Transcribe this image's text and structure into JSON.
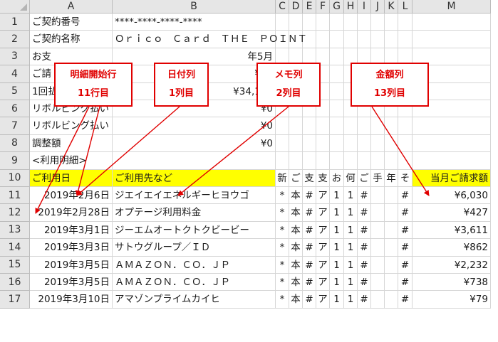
{
  "columns": [
    "A",
    "B",
    "C",
    "D",
    "E",
    "F",
    "G",
    "H",
    "I",
    "J",
    "K",
    "L",
    "M"
  ],
  "rows": [
    {
      "num": "1",
      "A": "ご契約番号",
      "B": "****-****-****-****"
    },
    {
      "num": "2",
      "A": "ご契約名称",
      "B": "Ｏｒｉｃｏ　Ｃａｒｄ　ＴＨＥ　ＰＯＩＮＴ"
    },
    {
      "num": "3",
      "A": "お支",
      "B": "年5月"
    },
    {
      "num": "4",
      "A": "ご請",
      "B": "¥34"
    },
    {
      "num": "5",
      "A": "1回払い分割払い",
      "B": "¥34,153"
    },
    {
      "num": "6",
      "A": "リボルビング払い",
      "B": "¥0"
    },
    {
      "num": "7",
      "A": "リボルビング払い",
      "B": "¥0"
    },
    {
      "num": "8",
      "A": "調整額",
      "B": "¥0"
    },
    {
      "num": "9",
      "A": "<利用明細>",
      "B": ""
    },
    {
      "num": "10",
      "A": "ご利用日",
      "B": "ご利用先など",
      "C": "新",
      "D": "ご",
      "E": "支",
      "F": "支",
      "G": "お",
      "H": "何",
      "I": "ご",
      "J": "手",
      "K": "年",
      "L": "そ",
      "M": "当月ご請求額"
    },
    {
      "num": "11",
      "A": "2019年2月6日",
      "B": "ジエイエイエネルギーヒヨウゴ",
      "C": "*",
      "D": "本",
      "E": "#",
      "F": "ア",
      "G": "1",
      "H": "1",
      "I": "#",
      "L": "#",
      "M": "¥6,030"
    },
    {
      "num": "12",
      "A": "2019年2月28日",
      "B": "オプテージ利用料金",
      "C": "*",
      "D": "本",
      "E": "#",
      "F": "ア",
      "G": "1",
      "H": "1",
      "I": "#",
      "L": "#",
      "M": "¥427"
    },
    {
      "num": "13",
      "A": "2019年3月1日",
      "B": "ジーエムオートクトクビービー",
      "C": "*",
      "D": "本",
      "E": "#",
      "F": "ア",
      "G": "1",
      "H": "1",
      "I": "#",
      "L": "#",
      "M": "¥3,611"
    },
    {
      "num": "14",
      "A": "2019年3月3日",
      "B": "サトウグループ／ＩＤ",
      "C": "*",
      "D": "本",
      "E": "#",
      "F": "ア",
      "G": "1",
      "H": "1",
      "I": "#",
      "L": "#",
      "M": "¥862"
    },
    {
      "num": "15",
      "A": "2019年3月5日",
      "B": "ＡＭＡＺＯＮ．ＣＯ．ＪＰ",
      "C": "*",
      "D": "本",
      "E": "#",
      "F": "ア",
      "G": "1",
      "H": "1",
      "I": "#",
      "L": "#",
      "M": "¥2,232"
    },
    {
      "num": "16",
      "A": "2019年3月5日",
      "B": "ＡＭＡＺＯＮ．ＣＯ．ＪＰ",
      "C": "*",
      "D": "本",
      "E": "#",
      "F": "ア",
      "G": "1",
      "H": "1",
      "I": "#",
      "L": "#",
      "M": "¥738"
    },
    {
      "num": "17",
      "A": "2019年3月10日",
      "B": "アマゾンプライムカイヒ",
      "C": "*",
      "D": "本",
      "E": "#",
      "F": "ア",
      "G": "1",
      "H": "1",
      "I": "#",
      "L": "#",
      "M": "¥79"
    }
  ],
  "callouts": [
    {
      "line1": "明細開始行",
      "line2": "11行目"
    },
    {
      "line1": "日付列",
      "line2": "1列目"
    },
    {
      "line1": "メモ列",
      "line2": "2列目"
    },
    {
      "line1": "金額列",
      "line2": "13列目"
    }
  ],
  "colors": {
    "highlight": "#ffff00",
    "callout": "#e00000",
    "header_bg": "#e6e6e6"
  }
}
